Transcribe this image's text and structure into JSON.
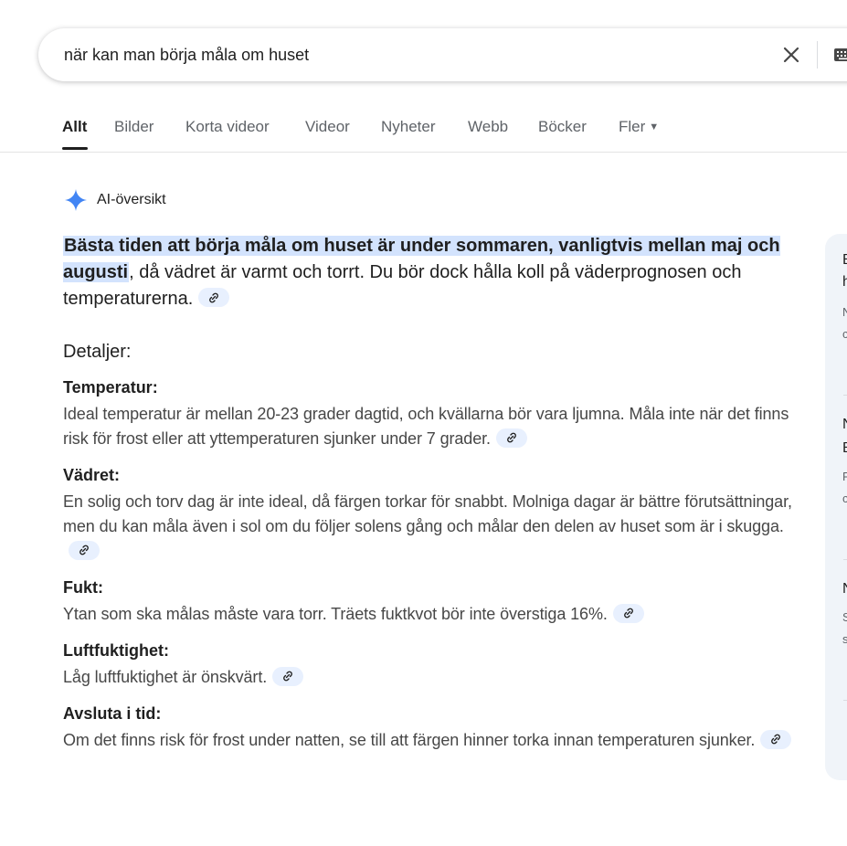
{
  "search": {
    "query": "när kan man börja måla om huset"
  },
  "tabs": [
    {
      "label": "Allt",
      "active": true
    },
    {
      "label": "Bilder"
    },
    {
      "label": "Korta videor"
    },
    {
      "label": "Videor"
    },
    {
      "label": "Nyheter"
    },
    {
      "label": "Webb"
    },
    {
      "label": "Böcker"
    },
    {
      "label": "Fler"
    }
  ],
  "ai_overview": {
    "label": "AI-översikt",
    "lead_highlight": "Bästa tiden att börja måla om huset är under sommaren, vanligtvis mellan maj och augusti",
    "lead_rest": ", då vädret är varmt och torrt. Du bör dock hålla koll på väderprognosen och temperaturerna.",
    "details_title": "Detaljer:",
    "sections": [
      {
        "title": "Temperatur:",
        "text": "Ideal temperatur är mellan 20-23 grader dagtid, och kvällarna bör vara ljumna. Måla inte när det finns risk för frost eller att yttemperaturen sjunker under 7 grader."
      },
      {
        "title": "Vädret:",
        "text": "En solig och torv dag är inte ideal, då färgen torkar för snabbt. Molniga dagar är bättre förutsättningar, men du kan måla även i sol om du följer solens gång och målar den delen av huset som är i skugga."
      },
      {
        "title": "Fukt:",
        "text": "Ytan som ska målas måste vara torr. Träets fuktkvot bör inte överstiga 16%."
      },
      {
        "title": "Luftfuktighet:",
        "text": "Låg luftfuktighet är önskvärt."
      },
      {
        "title": "Avsluta i tid:",
        "text": "Om det finns risk för frost under natten, se till att färgen hinner torka innan temperaturen sjunker."
      }
    ]
  },
  "right_panel": {
    "fragments": [
      "B",
      "h",
      "N",
      "c",
      "N",
      "B",
      "F",
      "c",
      "N",
      "S",
      "s"
    ]
  },
  "colors": {
    "highlight": "#d3e3fd",
    "chip": "#e8f0fe",
    "gemini_blue": "#4285f4",
    "panel_bg": "#f0f4f9"
  }
}
